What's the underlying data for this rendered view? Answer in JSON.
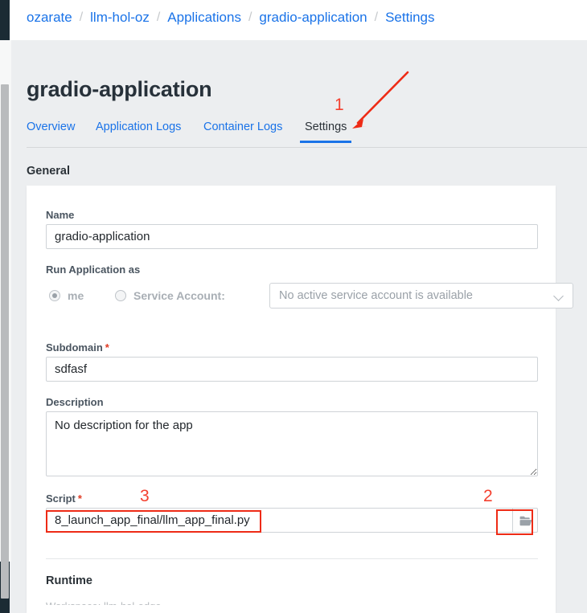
{
  "breadcrumb": {
    "separator": "/",
    "items": [
      {
        "label": "ozarate"
      },
      {
        "label": "llm-hol-oz"
      },
      {
        "label": "Applications"
      },
      {
        "label": "gradio-application"
      },
      {
        "label": "Settings"
      }
    ]
  },
  "page": {
    "title": "gradio-application"
  },
  "tabs": {
    "items": [
      {
        "label": "Overview",
        "active": false
      },
      {
        "label": "Application Logs",
        "active": false
      },
      {
        "label": "Container Logs",
        "active": false
      },
      {
        "label": "Settings",
        "active": true
      }
    ]
  },
  "sections": {
    "general_heading": "General",
    "runtime_heading": "Runtime"
  },
  "form": {
    "name": {
      "label": "Name",
      "value": "gradio-application",
      "placeholder": ""
    },
    "run_application_as": {
      "label": "Run Application as",
      "options": [
        {
          "label": "me",
          "selected": true
        },
        {
          "label": "Service Account:",
          "selected": false
        }
      ],
      "service_account_select": {
        "value": "No active service account is available",
        "placeholder": "No active service account is available"
      }
    },
    "subdomain": {
      "label": "Subdomain",
      "required_marker": "*",
      "value": "sdfasf",
      "placeholder": ""
    },
    "description": {
      "label": "Description",
      "value": "No description for the app",
      "placeholder": ""
    },
    "script": {
      "label": "Script",
      "required_marker": "*",
      "value": "8_launch_app_final/llm_app_final.py",
      "placeholder": "",
      "browse_icon": "folder-open-icon"
    }
  },
  "footer_cutoff": {
    "text": "Workspace:   llm-hol-edge"
  },
  "annotations": {
    "markers": [
      {
        "id": "1",
        "target": "settings-tab"
      },
      {
        "id": "2",
        "target": "script-browse-button"
      },
      {
        "id": "3",
        "target": "script-input"
      }
    ],
    "color": "#ee2b16"
  },
  "colors": {
    "link": "#1a73e8",
    "accent": "#1a73e8",
    "page_bg": "#eceef0",
    "card_bg": "#ffffff",
    "rail": "#1b2b34",
    "required": "#e03b24",
    "annotation": "#ee2b16"
  }
}
